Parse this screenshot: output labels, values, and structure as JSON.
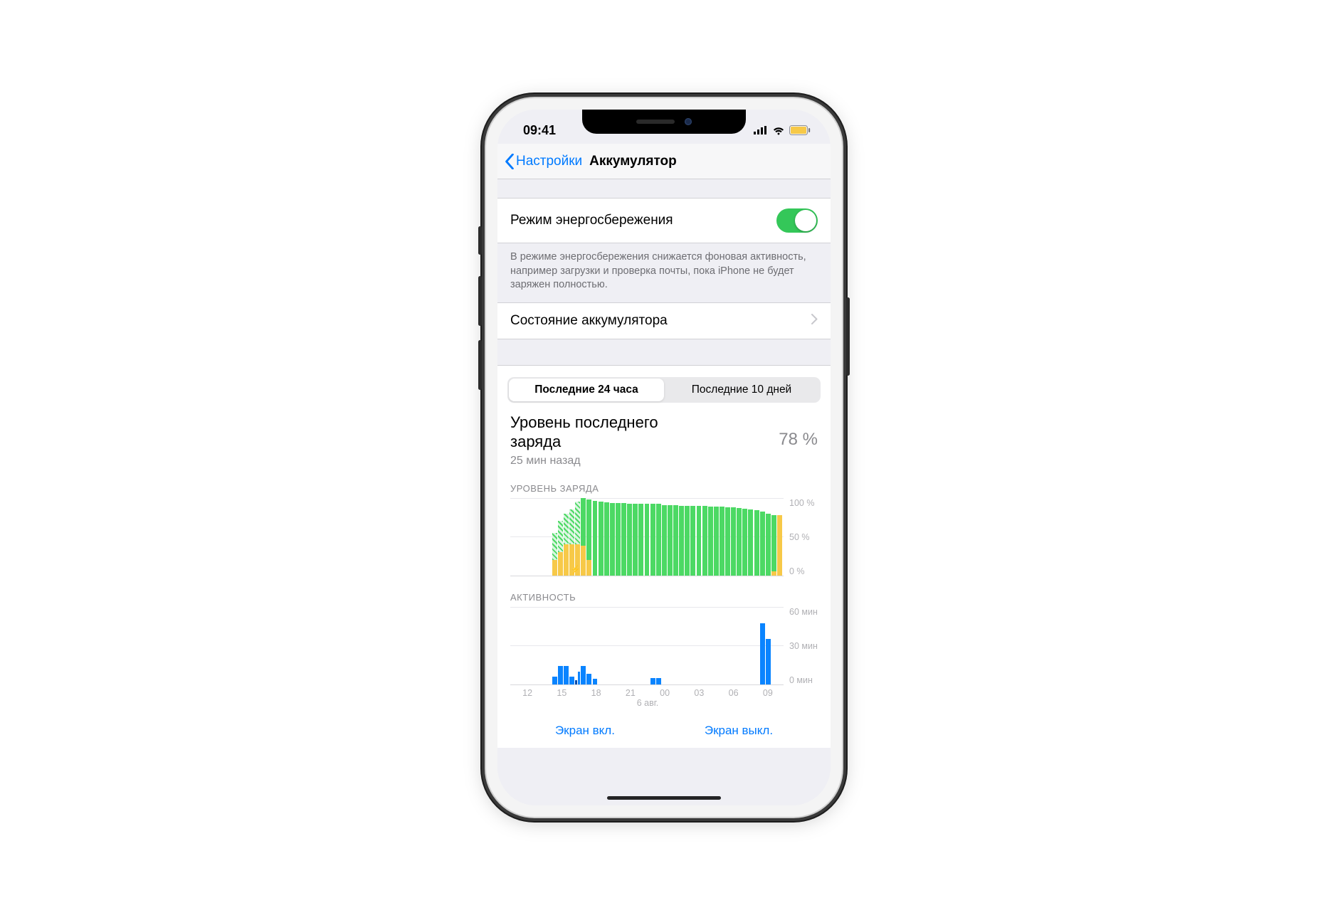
{
  "status": {
    "time": "09:41"
  },
  "nav": {
    "back": "Настройки",
    "title": "Аккумулятор"
  },
  "lowpower": {
    "label": "Режим энергосбережения",
    "note": "В режиме энергосбережения снижается фоновая активность, например загрузки и проверка почты, пока iPhone не будет заряжен полностью."
  },
  "health": {
    "label": "Состояние аккумулятора"
  },
  "seg": {
    "a": "Последние 24 часа",
    "b": "Последние 10 дней"
  },
  "last": {
    "title1": "Уровень последнего",
    "title2": "заряда",
    "sub": "25 мин назад",
    "val": "78 %"
  },
  "level_chart": {
    "label": "УРОВЕНЬ ЗАРЯДА",
    "ymax": "100 %",
    "ymid": "50 %",
    "ymin": "0 %"
  },
  "activity_chart": {
    "label": "АКТИВНОСТЬ",
    "ymax": "60 мин",
    "ymid": "30 мин",
    "ymin": "0 мин"
  },
  "xaxis": {
    "ticks": [
      "12",
      "15",
      "18",
      "21",
      "00",
      "03",
      "06",
      "09"
    ],
    "date": "6 авг."
  },
  "legend": {
    "on": "Экран вкл.",
    "off": "Экран выкл."
  },
  "chart_data": {
    "level": {
      "type": "bar",
      "ylim": [
        0,
        100
      ],
      "bars": [
        {
          "yellow": 0,
          "green": 0,
          "hatch": 0
        },
        {
          "yellow": 0,
          "green": 0,
          "hatch": 0
        },
        {
          "yellow": 0,
          "green": 0,
          "hatch": 0
        },
        {
          "yellow": 0,
          "green": 0,
          "hatch": 0
        },
        {
          "yellow": 0,
          "green": 0,
          "hatch": 0
        },
        {
          "yellow": 0,
          "green": 0,
          "hatch": 0
        },
        {
          "yellow": 0,
          "green": 0,
          "hatch": 0
        },
        {
          "yellow": 20,
          "green": 0,
          "hatch": 35
        },
        {
          "yellow": 30,
          "green": 0,
          "hatch": 40
        },
        {
          "yellow": 40,
          "green": 0,
          "hatch": 40
        },
        {
          "yellow": 40,
          "green": 0,
          "hatch": 45
        },
        {
          "yellow": 40,
          "green": 0,
          "hatch": 55
        },
        {
          "yellow": 38,
          "green": 62,
          "hatch": 0
        },
        {
          "yellow": 20,
          "green": 78,
          "hatch": 0
        },
        {
          "yellow": 0,
          "green": 96,
          "hatch": 0
        },
        {
          "yellow": 0,
          "green": 95,
          "hatch": 0
        },
        {
          "yellow": 0,
          "green": 94,
          "hatch": 0
        },
        {
          "yellow": 0,
          "green": 93,
          "hatch": 0
        },
        {
          "yellow": 0,
          "green": 93,
          "hatch": 0
        },
        {
          "yellow": 0,
          "green": 93,
          "hatch": 0
        },
        {
          "yellow": 0,
          "green": 92,
          "hatch": 0
        },
        {
          "yellow": 0,
          "green": 92,
          "hatch": 0
        },
        {
          "yellow": 0,
          "green": 92,
          "hatch": 0
        },
        {
          "yellow": 0,
          "green": 92,
          "hatch": 0
        },
        {
          "yellow": 0,
          "green": 92,
          "hatch": 0
        },
        {
          "yellow": 0,
          "green": 92,
          "hatch": 0
        },
        {
          "yellow": 0,
          "green": 91,
          "hatch": 0
        },
        {
          "yellow": 0,
          "green": 91,
          "hatch": 0
        },
        {
          "yellow": 0,
          "green": 91,
          "hatch": 0
        },
        {
          "yellow": 0,
          "green": 90,
          "hatch": 0
        },
        {
          "yellow": 0,
          "green": 90,
          "hatch": 0
        },
        {
          "yellow": 0,
          "green": 90,
          "hatch": 0
        },
        {
          "yellow": 0,
          "green": 90,
          "hatch": 0
        },
        {
          "yellow": 0,
          "green": 90,
          "hatch": 0
        },
        {
          "yellow": 0,
          "green": 89,
          "hatch": 0
        },
        {
          "yellow": 0,
          "green": 89,
          "hatch": 0
        },
        {
          "yellow": 0,
          "green": 89,
          "hatch": 0
        },
        {
          "yellow": 0,
          "green": 88,
          "hatch": 0
        },
        {
          "yellow": 0,
          "green": 88,
          "hatch": 0
        },
        {
          "yellow": 0,
          "green": 87,
          "hatch": 0
        },
        {
          "yellow": 0,
          "green": 86,
          "hatch": 0
        },
        {
          "yellow": 0,
          "green": 85,
          "hatch": 0
        },
        {
          "yellow": 0,
          "green": 84,
          "hatch": 0
        },
        {
          "yellow": 0,
          "green": 82,
          "hatch": 0
        },
        {
          "yellow": 0,
          "green": 80,
          "hatch": 0
        },
        {
          "yellow": 5,
          "green": 73,
          "hatch": 0
        },
        {
          "yellow": 78,
          "green": 0,
          "hatch": 0
        }
      ]
    },
    "activity": {
      "type": "bar",
      "ylim": [
        0,
        60
      ],
      "bars": [
        {
          "on": 0,
          "off": 0
        },
        {
          "on": 0,
          "off": 0
        },
        {
          "on": 0,
          "off": 0
        },
        {
          "on": 0,
          "off": 0
        },
        {
          "on": 0,
          "off": 0
        },
        {
          "on": 0,
          "off": 0
        },
        {
          "on": 0,
          "off": 0
        },
        {
          "on": 6,
          "off": 0
        },
        {
          "on": 14,
          "off": 0
        },
        {
          "on": 14,
          "off": 0
        },
        {
          "on": 6,
          "off": 0
        },
        {
          "on": 10,
          "off": 3
        },
        {
          "on": 14,
          "off": 0
        },
        {
          "on": 8,
          "off": 0
        },
        {
          "on": 4,
          "off": 0
        },
        {
          "on": 0,
          "off": 0
        },
        {
          "on": 0,
          "off": 0
        },
        {
          "on": 0,
          "off": 0
        },
        {
          "on": 0,
          "off": 0
        },
        {
          "on": 0,
          "off": 0
        },
        {
          "on": 0,
          "off": 0
        },
        {
          "on": 0,
          "off": 0
        },
        {
          "on": 0,
          "off": 0
        },
        {
          "on": 0,
          "off": 0
        },
        {
          "on": 5,
          "off": 0
        },
        {
          "on": 5,
          "off": 0
        },
        {
          "on": 0,
          "off": 0
        },
        {
          "on": 0,
          "off": 0
        },
        {
          "on": 0,
          "off": 0
        },
        {
          "on": 0,
          "off": 0
        },
        {
          "on": 0,
          "off": 0
        },
        {
          "on": 0,
          "off": 0
        },
        {
          "on": 0,
          "off": 0
        },
        {
          "on": 0,
          "off": 0
        },
        {
          "on": 0,
          "off": 0
        },
        {
          "on": 0,
          "off": 0
        },
        {
          "on": 0,
          "off": 0
        },
        {
          "on": 0,
          "off": 0
        },
        {
          "on": 0,
          "off": 0
        },
        {
          "on": 0,
          "off": 0
        },
        {
          "on": 0,
          "off": 0
        },
        {
          "on": 0,
          "off": 0
        },
        {
          "on": 0,
          "off": 0
        },
        {
          "on": 47,
          "off": 0
        },
        {
          "on": 35,
          "off": 0
        },
        {
          "on": 0,
          "off": 0
        },
        {
          "on": 0,
          "off": 0
        }
      ]
    }
  }
}
